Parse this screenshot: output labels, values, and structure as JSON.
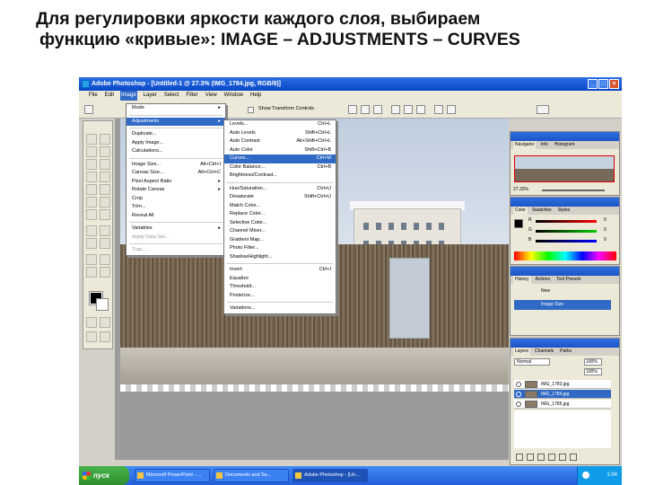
{
  "caption": {
    "line1": "Для регулировки яркости каждого слоя, выбираем",
    "line2": "функцию «кривые»: IMAGE – ADJUSTMENTS – CURVES"
  },
  "window": {
    "title": "Adobe Photoshop - [Untitled-1 @ 27.3% (IMG_1784.jpg, RGB/8)]",
    "buttons": [
      "_",
      "□",
      "×"
    ]
  },
  "menubar": [
    "File",
    "Edit",
    "Image",
    "Layer",
    "Select",
    "Filter",
    "View",
    "Window",
    "Help"
  ],
  "options_bar": {
    "checkbox_label": "Show Transform Controls"
  },
  "image_menu": [
    {
      "label": "Mode",
      "shortcut": "",
      "arrow": true
    },
    {
      "sep": true
    },
    {
      "label": "Adjustments",
      "shortcut": "",
      "arrow": true,
      "highlight": true
    },
    {
      "sep": true
    },
    {
      "label": "Duplicate...",
      "shortcut": ""
    },
    {
      "label": "Apply Image...",
      "shortcut": ""
    },
    {
      "label": "Calculations...",
      "shortcut": ""
    },
    {
      "sep": true
    },
    {
      "label": "Image Size...",
      "shortcut": "Alt+Ctrl+I"
    },
    {
      "label": "Canvas Size...",
      "shortcut": "Alt+Ctrl+C"
    },
    {
      "label": "Pixel Aspect Ratio",
      "shortcut": "",
      "arrow": true
    },
    {
      "label": "Rotate Canvas",
      "shortcut": "",
      "arrow": true
    },
    {
      "label": "Crop",
      "shortcut": ""
    },
    {
      "label": "Trim...",
      "shortcut": ""
    },
    {
      "label": "Reveal All",
      "shortcut": ""
    },
    {
      "sep": true
    },
    {
      "label": "Variables",
      "shortcut": "",
      "arrow": true
    },
    {
      "label": "Apply Data Set...",
      "shortcut": "",
      "disabled": true
    },
    {
      "sep": true
    },
    {
      "label": "Trap...",
      "shortcut": "",
      "disabled": true
    }
  ],
  "adjust_menu": [
    {
      "label": "Levels...",
      "shortcut": "Ctrl+L"
    },
    {
      "label": "Auto Levels",
      "shortcut": "Shift+Ctrl+L"
    },
    {
      "label": "Auto Contrast",
      "shortcut": "Alt+Shift+Ctrl+L"
    },
    {
      "label": "Auto Color",
      "shortcut": "Shift+Ctrl+B"
    },
    {
      "label": "Curves...",
      "shortcut": "Ctrl+M",
      "highlight": true
    },
    {
      "label": "Color Balance...",
      "shortcut": "Ctrl+B"
    },
    {
      "label": "Brightness/Contrast...",
      "shortcut": ""
    },
    {
      "sep": true
    },
    {
      "label": "Hue/Saturation...",
      "shortcut": "Ctrl+U"
    },
    {
      "label": "Desaturate",
      "shortcut": "Shift+Ctrl+U"
    },
    {
      "label": "Match Color...",
      "shortcut": ""
    },
    {
      "label": "Replace Color...",
      "shortcut": ""
    },
    {
      "label": "Selective Color...",
      "shortcut": ""
    },
    {
      "label": "Channel Mixer...",
      "shortcut": ""
    },
    {
      "label": "Gradient Map...",
      "shortcut": ""
    },
    {
      "label": "Photo Filter...",
      "shortcut": ""
    },
    {
      "label": "Shadow/Highlight...",
      "shortcut": ""
    },
    {
      "sep": true
    },
    {
      "label": "Invert",
      "shortcut": "Ctrl+I"
    },
    {
      "label": "Equalize",
      "shortcut": ""
    },
    {
      "label": "Threshold...",
      "shortcut": ""
    },
    {
      "label": "Posterize...",
      "shortcut": ""
    },
    {
      "sep": true
    },
    {
      "label": "Variations...",
      "shortcut": ""
    }
  ],
  "navigator": {
    "tabs": [
      "Navigator",
      "Info",
      "Histogram"
    ],
    "zoom": "27.33%"
  },
  "color_panel": {
    "tabs": [
      "Color",
      "Swatches",
      "Styles"
    ],
    "channels": [
      "R",
      "G",
      "B"
    ],
    "values": [
      "0",
      "0",
      "0"
    ]
  },
  "history_panel": {
    "tabs": [
      "History",
      "Actions",
      "Tool Presets"
    ],
    "items": [
      "New",
      "Image Size"
    ]
  },
  "layers_panel": {
    "tabs": [
      "Layers",
      "Channels",
      "Paths"
    ],
    "blend_mode": "Normal",
    "opacity": "100%",
    "fill": "100%",
    "layers": [
      "IMG_1783.jpg",
      "IMG_1784.jpg",
      "IMG_1785.jpg"
    ],
    "selected": 1
  },
  "taskbar": {
    "start": "пуск",
    "buttons": [
      "Microsoft PowerPoint - ...",
      "Documents and Se...",
      "Adobe Photoshop - [Un..."
    ],
    "clock": "1:04"
  }
}
